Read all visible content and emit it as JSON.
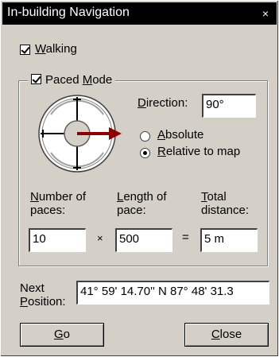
{
  "window": {
    "title": "In-building Navigation",
    "close_glyph": "×"
  },
  "walking": {
    "label": "Walking",
    "accel": "W",
    "rest": "alking",
    "checked": true
  },
  "paced_mode": {
    "label_pre": "Paced ",
    "accel": "M",
    "label_post": "ode",
    "checked": true
  },
  "direction": {
    "label_accel": "D",
    "label_rest": "irection:",
    "value": "90°"
  },
  "direction_mode": {
    "absolute": {
      "accel": "A",
      "rest": "bsolute",
      "selected": false
    },
    "relative": {
      "accel": "R",
      "rest": "elative to map",
      "selected": true
    }
  },
  "compass": {
    "icon": "compass-icon",
    "arrow_color": "#8b0000"
  },
  "paces": {
    "label_line1_accel": "N",
    "label_line1_rest": "umber of",
    "label_line2": "paces:",
    "value": "10"
  },
  "length": {
    "label_line1_accel": "L",
    "label_line1_rest": "ength of",
    "label_line2": "pace:",
    "value": "500"
  },
  "total": {
    "label_line1_accel": "T",
    "label_line1_rest": "otal",
    "label_line2": "distance:",
    "value": "5 m"
  },
  "operators": {
    "times": "×",
    "equals": "="
  },
  "next_position": {
    "label_line1": "Next",
    "label_line2_accel": "P",
    "label_line2_rest": "osition:",
    "value": "41° 59' 14.70'' N 87° 48' 31.3"
  },
  "buttons": {
    "go": {
      "accel": "G",
      "rest": "o"
    },
    "close": {
      "accel": "C",
      "rest": "lose"
    }
  }
}
